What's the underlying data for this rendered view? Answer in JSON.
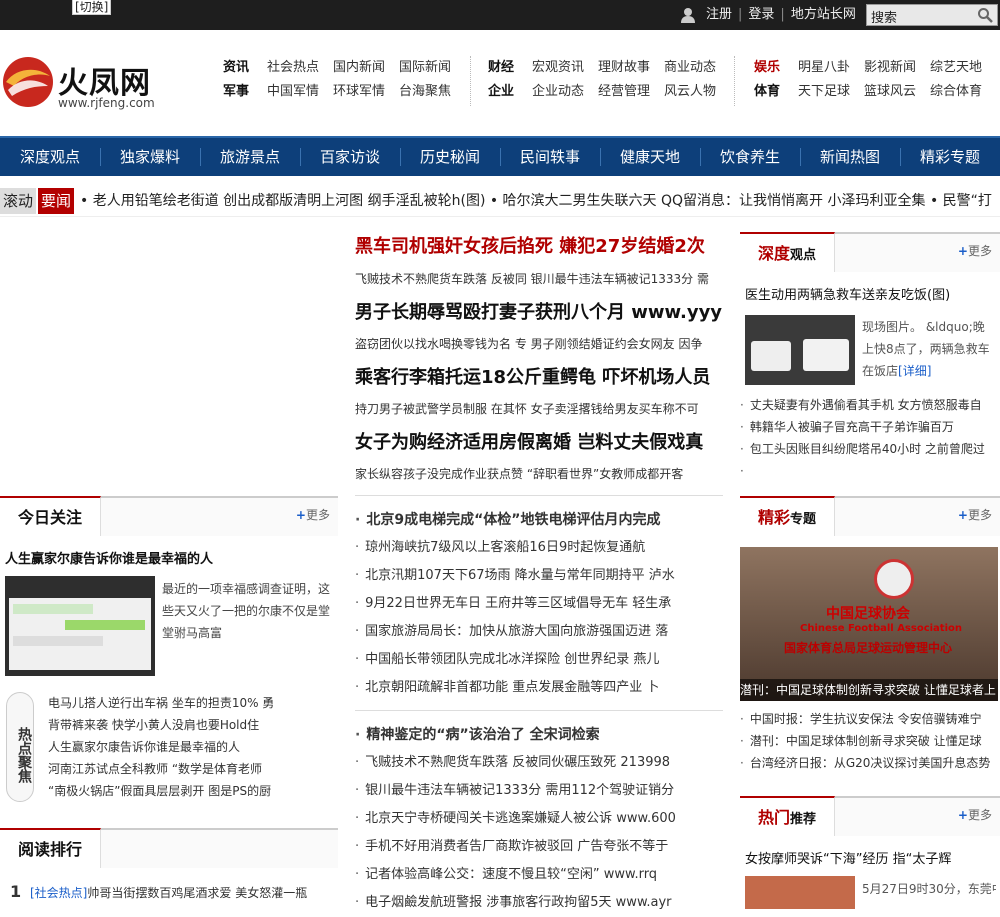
{
  "topbar": {
    "switch_label": "[切换]",
    "register": "注册",
    "login": "登录",
    "local": "地方站长网",
    "search_placeholder": "搜索"
  },
  "logo": {
    "name": "火凤网",
    "url": "www.rjfeng.com"
  },
  "header_nav": {
    "block1": {
      "row1": [
        "资讯",
        "社会热点",
        "国内新闻",
        "国际新闻"
      ],
      "row2": [
        "军事",
        "中国军情",
        "环球军情",
        "台海聚焦"
      ]
    },
    "block2": {
      "row1": [
        "财经",
        "宏观资讯",
        "理财故事",
        "商业动态"
      ],
      "row2": [
        "企业",
        "企业动态",
        "经营管理",
        "风云人物"
      ]
    },
    "block3": {
      "row1": [
        "娱乐",
        "明星八卦",
        "影视新闻",
        "综艺天地"
      ],
      "row2": [
        "体育",
        "天下足球",
        "篮球风云",
        "综合体育"
      ]
    }
  },
  "main_nav": [
    "深度观点",
    "独家爆料",
    "旅游景点",
    "百家访谈",
    "历史秘闻",
    "民间轶事",
    "健康天地",
    "饮食养生",
    "新闻热图",
    "精彩专题"
  ],
  "ticker": {
    "label1": "滚动",
    "label2": "要闻",
    "text": "• 老人用铅笔绘老街道  创出成都版清明上河图  纲手淫乱被轮h(图)  • 哈尔滨大二男生失联六天  QQ留消息：让我悄悄离开  小泽玛利亚全集  • 民警“打"
  },
  "headlines": [
    {
      "title": "黑车司机强奸女孩后掐死 嫌犯27岁结婚2次",
      "sub": "飞贼技术不熟爬货车跌落 反被同   银川最牛违法车辆被记1333分 需"
    },
    {
      "title": "男子长期辱骂殴打妻子获刑八个月 www.yyy",
      "sub": "盗窃团伙以找水喝换零钱为名 专   男子刚领结婚证约会女网友 因争"
    },
    {
      "title": "乘客行李箱托运18公斤重鳄龟 吓坏机场人员",
      "sub": "持刀男子被武警学员制服 在其怀   女子卖淫撂钱给男友买车称不可"
    },
    {
      "title": "女子为购经济适用房假离婚 岂料丈夫假戏真",
      "sub": "家长纵容孩子没完成作业获点赞   “辞职看世界”女教师成都开客"
    }
  ],
  "list1": {
    "title": "北京9成电梯完成“体检”地铁电梯评估月内完成",
    "items": [
      "琼州海峡抗7级风以上客滚船16日9时起恢复通航",
      "北京汛期107天下67场雨  降水量与常年同期持平  泸水",
      "9月22日世界无车日  王府井等三区域倡导无车  轻生承",
      "国家旅游局局长：加快从旅游大国向旅游强国迈进  落",
      "中国船长带领团队完成北冰洋探险  创世界纪录  燕儿",
      "北京朝阳疏解非首都功能  重点发展金融等四产业  卜"
    ]
  },
  "list2": {
    "title": "精神鉴定的“病”该治治了  全宋词检索",
    "items": [
      "飞贼技术不熟爬货车跌落  反被同伙碾压致死  213998",
      "银川最牛违法车辆被记1333分  需用112个驾驶证销分",
      "北京天宁寺桥硬闯关卡逃逸案嫌疑人被公诉  www.600",
      "手机不好用消费者告厂商欺诈被驳回  广告夸张不等于",
      "记者体验高峰公交：速度不慢且较“空闲”  www.rrq",
      "电子烟鹼发航班警报  涉事旅客行政拘留5天  www.ayr"
    ]
  },
  "today": {
    "tab": "今日关注",
    "more": "更多",
    "headline": "人生赢家尔康告诉你谁是最幸福的人",
    "desc": "最近的一项幸福感调查证明，这些天又火了一把的尔康不仅是堂堂驸马高富",
    "hot_label": "热点聚焦",
    "hot_items": [
      "电马儿搭人逆行出车祸  坐车的担责10%  勇",
      "背带裤来袭  快学小黄人没肩也要Hold住",
      "人生赢家尔康告诉你谁是最幸福的人",
      "河南江苏试点全科教师  “数学是体育老师",
      "“南极火锅店”假面具层层剥开  图是PS的厨"
    ]
  },
  "reading": {
    "tab": "阅读排行",
    "items": [
      {
        "num": "1",
        "cat": "[社会热点]",
        "text": "帅哥当街摆数百鸡尾酒求爱  美女怒灌一瓶"
      }
    ]
  },
  "depth": {
    "tab_red": "深度",
    "tab_black": "观点",
    "more": "更多",
    "headline": "医生动用两辆急救车送亲友吃饭(图)",
    "desc": "现场图片。 &ldquo;晚上快8点了，两辆急救车在饭店",
    "detail": "[详细]",
    "items": [
      "丈夫疑妻有外遇偷看其手机  女方愤怒服毒自",
      "韩籍华人被骗子冒充高干子弟诈骗百万",
      "包工头因账目纠纷爬塔吊40小时  之前曾爬过"
    ]
  },
  "special": {
    "tab_red": "精彩",
    "tab_black": "专题",
    "more": "更多",
    "caption": "潜刊：中国足球体制创新寻求突破  让懂足球者上",
    "image_text_cn": "中国足球协会",
    "image_text_en": "Chinese Football Association",
    "image_text_sub": "国家体育总局足球运动管理中心",
    "items": [
      "中国时报：学生抗议安保法  令安倍骥铸难宁",
      "潜刊：中国足球体制创新寻求突破  让懂足球",
      "台湾经济日报：从G20决议探讨美国升息态势"
    ]
  },
  "hot": {
    "tab_red": "热门",
    "tab_black": "推荐",
    "more": "更多",
    "headline": "女按摩师哭诉“下海”经历 指“太子辉",
    "desc": "5月27日9时30分，东莞中"
  },
  "colors": {
    "brand_red": "#b00000",
    "nav_blue": "#0d3f7a",
    "link_blue": "#1a5ec9"
  }
}
